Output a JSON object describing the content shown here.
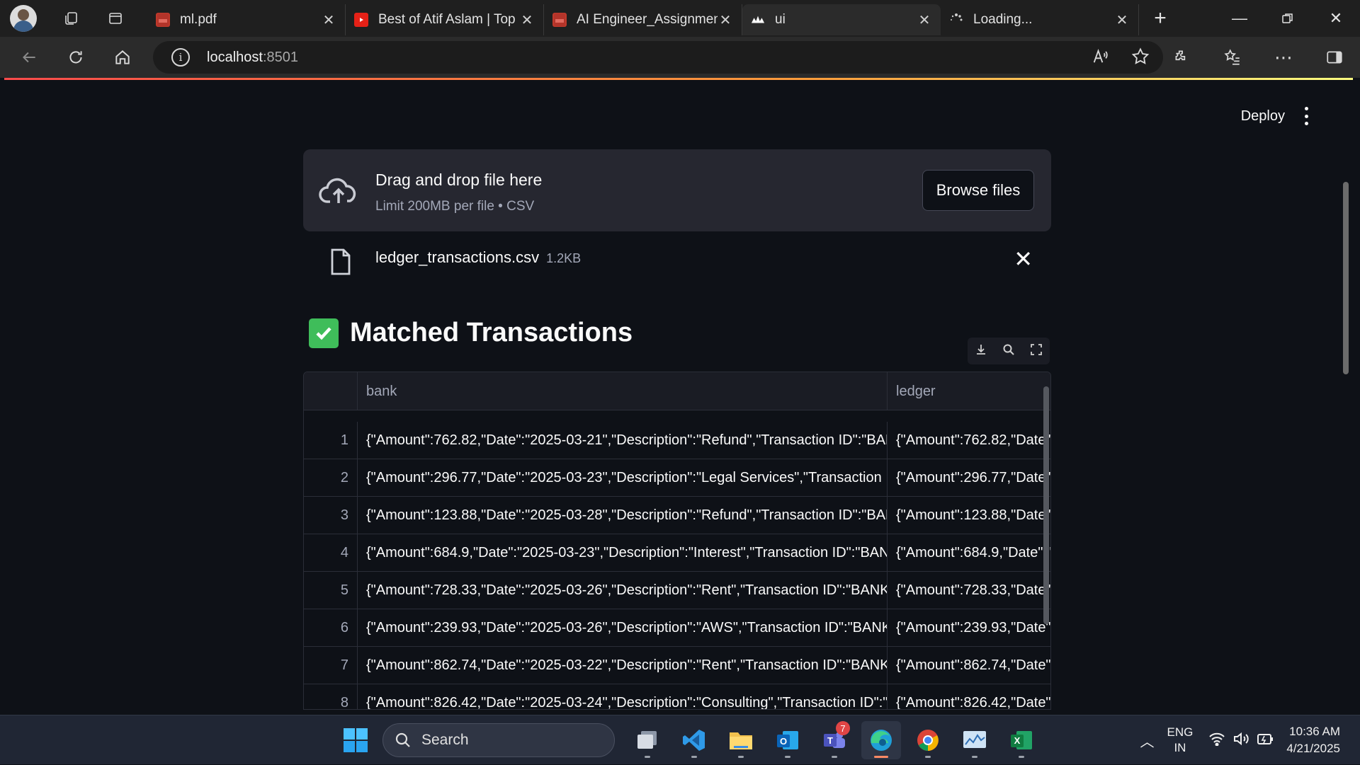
{
  "browser": {
    "tabs": [
      {
        "title": "ml.pdf",
        "icon": "pdf-icon"
      },
      {
        "title": "Best of Atif Aslam | Top",
        "icon": "youtube-icon"
      },
      {
        "title": "AI Engineer_Assignmen",
        "icon": "pdf-icon"
      },
      {
        "title": "ui",
        "icon": "streamlit-icon",
        "active": true
      },
      {
        "title": "Loading...",
        "icon": "loading-spinner-icon"
      }
    ],
    "url_host": "localhost",
    "url_port": ":8501"
  },
  "app": {
    "deploy_label": "Deploy",
    "uploader": {
      "title": "Drag and drop file here",
      "limit": "Limit 200MB per file • CSV",
      "browse_label": "Browse files"
    },
    "file": {
      "name": "ledger_transactions.csv",
      "size": "1.2KB"
    },
    "section_title": "Matched Transactions",
    "table": {
      "columns": [
        "bank",
        "ledger"
      ],
      "rows": [
        {
          "idx": "1",
          "bank": "{\"Amount\":762.82,\"Date\":\"2025-03-21\",\"Description\":\"Refund\",\"Transaction ID\":\"BAN",
          "ledger": "{\"Amount\":762.82,\"Date\""
        },
        {
          "idx": "2",
          "bank": "{\"Amount\":296.77,\"Date\":\"2025-03-23\",\"Description\":\"Legal Services\",\"Transaction ID",
          "ledger": "{\"Amount\":296.77,\"Date\""
        },
        {
          "idx": "3",
          "bank": "{\"Amount\":123.88,\"Date\":\"2025-03-28\",\"Description\":\"Refund\",\"Transaction ID\":\"BAN",
          "ledger": "{\"Amount\":123.88,\"Date\""
        },
        {
          "idx": "4",
          "bank": "{\"Amount\":684.9,\"Date\":\"2025-03-23\",\"Description\":\"Interest\",\"Transaction ID\":\"BANI",
          "ledger": "{\"Amount\":684.9,\"Date\":\""
        },
        {
          "idx": "5",
          "bank": "{\"Amount\":728.33,\"Date\":\"2025-03-26\",\"Description\":\"Rent\",\"Transaction ID\":\"BANK-(",
          "ledger": "{\"Amount\":728.33,\"Date\""
        },
        {
          "idx": "6",
          "bank": "{\"Amount\":239.93,\"Date\":\"2025-03-26\",\"Description\":\"AWS\",\"Transaction ID\":\"BANK-(",
          "ledger": "{\"Amount\":239.93,\"Date\""
        },
        {
          "idx": "7",
          "bank": "{\"Amount\":862.74,\"Date\":\"2025-03-22\",\"Description\":\"Rent\",\"Transaction ID\":\"BANK-(",
          "ledger": "{\"Amount\":862.74,\"Date\""
        },
        {
          "idx": "8",
          "bank": "{\"Amount\":826.42,\"Date\":\"2025-03-24\",\"Description\":\"Consulting\",\"Transaction ID\":\"I",
          "ledger": "{\"Amount\":826.42,\"Date\""
        }
      ]
    }
  },
  "taskbar": {
    "search_label": "Search",
    "teams_badge": "7",
    "lang_top": "ENG",
    "lang_bottom": "IN",
    "time": "10:36 AM",
    "date": "4/21/2025"
  },
  "colors": {
    "app_bg": "#0e1117",
    "uploader_bg": "#262730",
    "check_green": "#3fbd5a",
    "progress_red": "#ff4b4b"
  }
}
